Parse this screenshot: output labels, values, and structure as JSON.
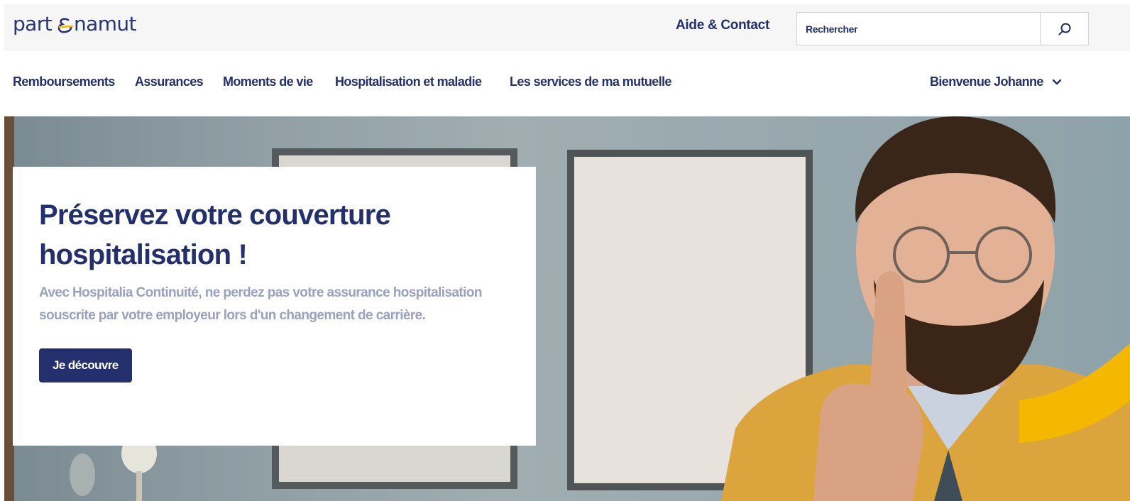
{
  "header": {
    "logo_text": "partenamut",
    "help_link": "Aide & Contact",
    "search": {
      "placeholder": "Rechercher",
      "value": ""
    }
  },
  "nav": {
    "items": [
      {
        "label": "Remboursements"
      },
      {
        "label": "Assurances"
      },
      {
        "label": "Moments de vie"
      },
      {
        "label": "Hospitalisation et maladie"
      },
      {
        "label": "Les services de ma mutuelle"
      }
    ],
    "user_greeting": "Bienvenue Johanne"
  },
  "hero": {
    "title": "Préservez votre couverture hospitalisation !",
    "text": "Avec Hospitalia Continuité, ne perdez pas votre assurance hospitalisation souscrite par votre employeur lors d'un changement de carrière.",
    "cta_label": "Je découvre"
  },
  "colors": {
    "brand_navy": "#24306e",
    "accent_yellow": "#f5b800",
    "muted_text": "#9aa0bf"
  },
  "icons": {
    "search": "search-icon",
    "chevron": "chevron-down-icon"
  }
}
